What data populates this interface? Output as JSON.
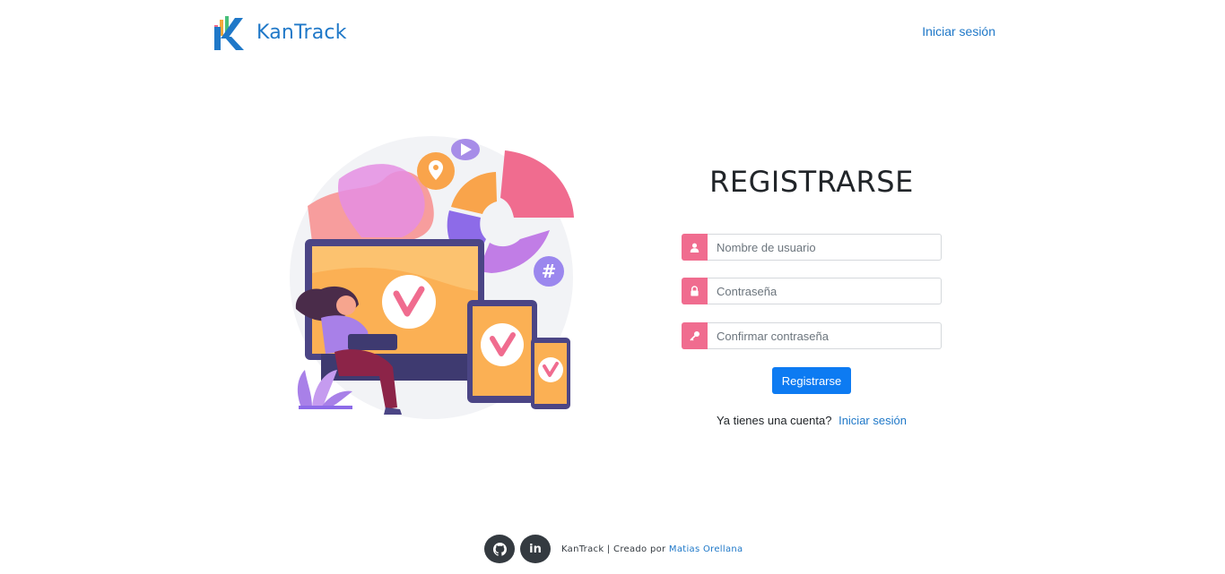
{
  "header": {
    "brand_name": "KanTrack",
    "login_link": "Iniciar sesión"
  },
  "form": {
    "title": "REGISTRARSE",
    "username_placeholder": "Nombre de usuario",
    "password_placeholder": "Contraseña",
    "confirm_placeholder": "Confirmar contraseña",
    "submit_label": "Registrarse",
    "account_question": "Ya tienes una cuenta?",
    "account_login_link": "Iniciar sesión"
  },
  "footer": {
    "github_icon": "github-icon",
    "linkedin_icon": "linkedin-icon",
    "linkedin_text": "in",
    "credits_prefix": "KanTrack | Creado por",
    "author_name": "Matias Orellana"
  },
  "colors": {
    "brand_blue": "#1f78c8",
    "accent_pink": "#f06c8f",
    "button_blue": "#0d7bf2",
    "footer_dark": "#343a40"
  },
  "icons": {
    "username": "user-icon",
    "password": "lock-icon",
    "confirm": "key-icon"
  }
}
